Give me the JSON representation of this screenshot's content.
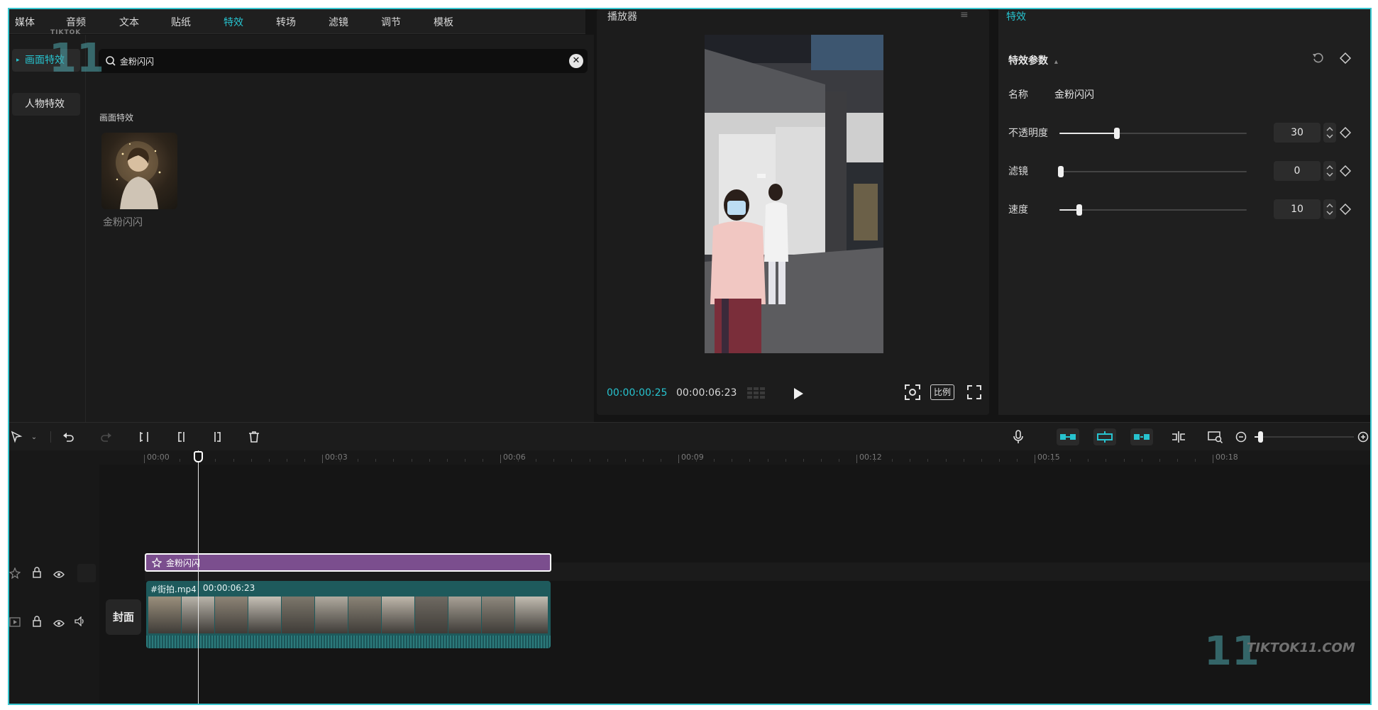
{
  "topnav": {
    "tabs": [
      "媒体",
      "音频",
      "文本",
      "贴纸",
      "特效",
      "转场",
      "滤镜",
      "调节",
      "模板"
    ],
    "active_index": 4
  },
  "sidebar": {
    "items": [
      {
        "label": "画面特效",
        "active": true
      },
      {
        "label": "人物特效",
        "active": false
      }
    ]
  },
  "search": {
    "value": "金粉闪闪"
  },
  "effects": {
    "section_title": "画面特效",
    "items": [
      {
        "name": "金粉闪闪"
      }
    ]
  },
  "player": {
    "title": "播放器",
    "current_time": "00:00:00:25",
    "total_time": "00:00:06:23",
    "ratio_label": "比例"
  },
  "props": {
    "panel_title": "特效",
    "section_title": "特效参数",
    "name_label": "名称",
    "name_value": "金粉闪闪",
    "params": [
      {
        "label": "不透明度",
        "value": "30",
        "fraction": 0.3
      },
      {
        "label": "滤镜",
        "value": "0",
        "fraction": 0.0
      },
      {
        "label": "速度",
        "value": "10",
        "fraction": 0.1
      }
    ]
  },
  "timeline": {
    "ticks": [
      "00:00",
      "00:03",
      "00:06",
      "00:09",
      "00:12",
      "00:15",
      "00:18"
    ],
    "effect_clip_label": "金粉闪闪",
    "video_clip_name": "#街拍.mp4",
    "video_clip_duration": "00:00:06:23",
    "cover_label": "封面",
    "zoom_fraction": 0.06
  },
  "watermark": {
    "top_small": "TIKTOK",
    "number": "11",
    "brand": "TIKTOK11.COM"
  },
  "colors": {
    "accent": "#27c3cf",
    "effect_clip": "#7b4e8e",
    "video_clip": "#1e5a5c"
  }
}
